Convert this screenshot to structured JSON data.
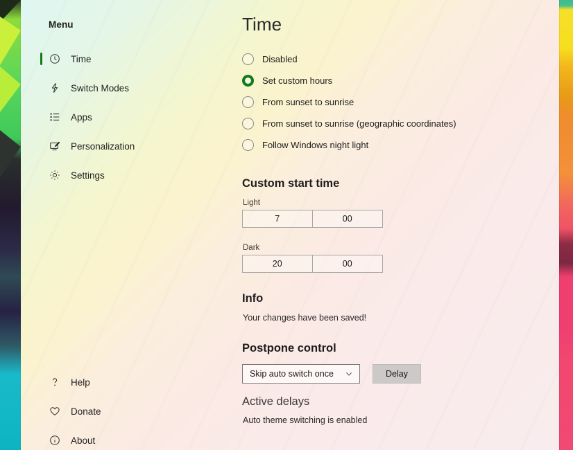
{
  "window": {
    "accent_color": "#107c10",
    "background_top_left": "#dff6f2",
    "background_bottom_right": "#f9ecee"
  },
  "sidebar": {
    "title": "Menu",
    "items": [
      {
        "label": "Time",
        "icon": "clock-icon",
        "active": true
      },
      {
        "label": "Switch Modes",
        "icon": "lightning-bolt-icon",
        "active": false
      },
      {
        "label": "Apps",
        "icon": "list-icon",
        "active": false
      },
      {
        "label": "Personalization",
        "icon": "pen-screen-icon",
        "active": false
      },
      {
        "label": "Settings",
        "icon": "gear-icon",
        "active": false
      }
    ],
    "bottom_items": [
      {
        "label": "Help",
        "icon": "question-mark-icon"
      },
      {
        "label": "Donate",
        "icon": "heart-icon"
      },
      {
        "label": "About",
        "icon": "info-circle-icon"
      }
    ]
  },
  "main": {
    "title": "Time",
    "time_options": [
      {
        "label": "Disabled",
        "selected": false
      },
      {
        "label": "Set custom hours",
        "selected": true
      },
      {
        "label": "From sunset to sunrise",
        "selected": false
      },
      {
        "label": "From sunset to sunrise (geographic coordinates)",
        "selected": false
      },
      {
        "label": "Follow Windows night light",
        "selected": false
      }
    ],
    "custom_start_time": {
      "heading": "Custom start time",
      "light": {
        "label": "Light",
        "hours": "7",
        "minutes": "00"
      },
      "dark": {
        "label": "Dark",
        "hours": "20",
        "minutes": "00"
      }
    },
    "info": {
      "heading": "Info",
      "message": "Your changes have been saved!"
    },
    "postpone": {
      "heading": "Postpone control",
      "dropdown_value": "Skip auto switch once",
      "dropdown_icon": "chevron-down-icon",
      "button_label": "Delay"
    },
    "active_delays": {
      "heading": "Active delays",
      "message": "Auto theme switching is enabled"
    }
  }
}
